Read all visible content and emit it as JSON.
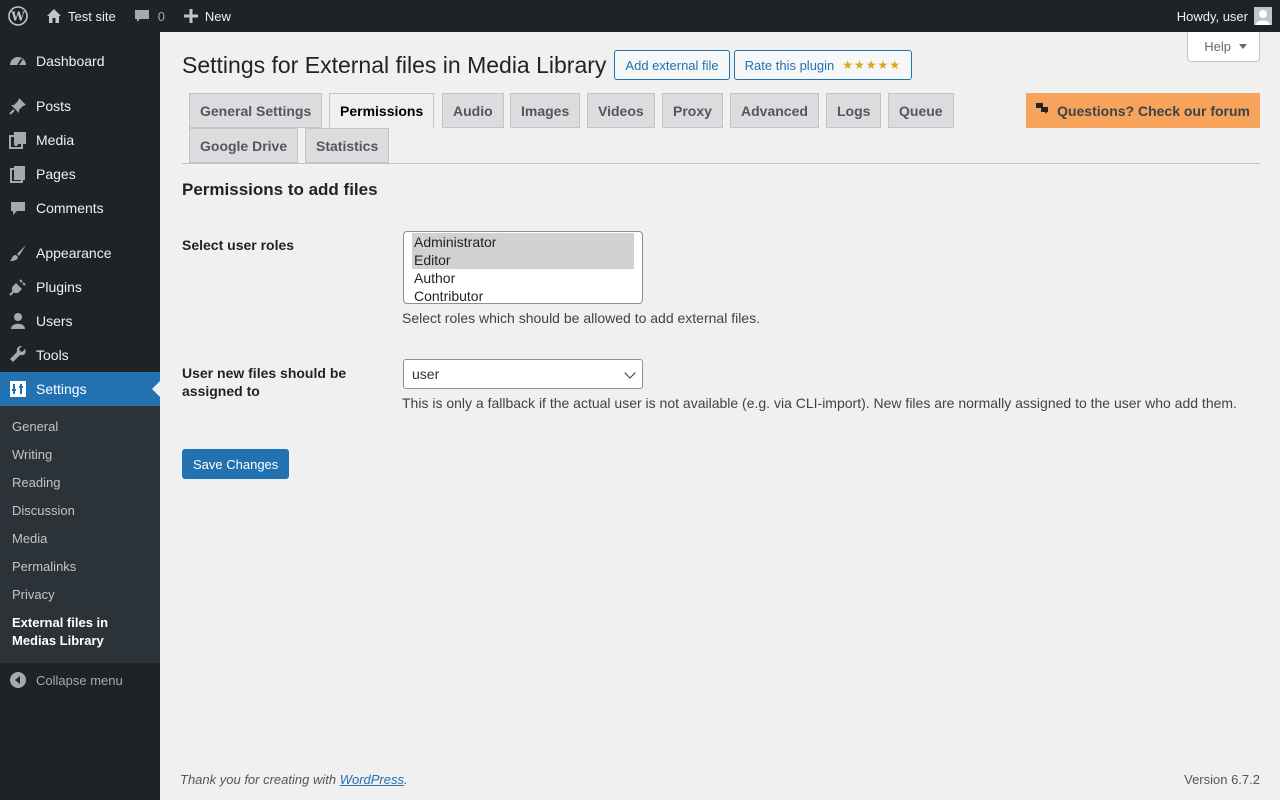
{
  "adminbar": {
    "site_name": "Test site",
    "comments_count": "0",
    "new_label": "New",
    "howdy": "Howdy, user"
  },
  "sidebar": {
    "items": [
      {
        "label": "Dashboard",
        "icon": "dashboard-icon"
      },
      {
        "label": "Posts",
        "icon": "pin-icon"
      },
      {
        "label": "Media",
        "icon": "media-icon"
      },
      {
        "label": "Pages",
        "icon": "pages-icon"
      },
      {
        "label": "Comments",
        "icon": "comment-icon"
      },
      {
        "label": "Appearance",
        "icon": "brush-icon"
      },
      {
        "label": "Plugins",
        "icon": "plug-icon"
      },
      {
        "label": "Users",
        "icon": "user-icon"
      },
      {
        "label": "Tools",
        "icon": "wrench-icon"
      },
      {
        "label": "Settings",
        "icon": "settings-icon"
      }
    ],
    "submenu": [
      "General",
      "Writing",
      "Reading",
      "Discussion",
      "Media",
      "Permalinks",
      "Privacy",
      "External files in Medias Library"
    ],
    "collapse_label": "Collapse menu"
  },
  "header": {
    "help_label": "Help",
    "title": "Settings for External files in Media Library",
    "add_button": "Add external file",
    "rate_button": "Rate this plugin",
    "stars": "★★★★★"
  },
  "tabs": [
    "General Settings",
    "Permissions",
    "Audio",
    "Images",
    "Videos",
    "Proxy",
    "Advanced",
    "Logs",
    "Queue",
    "Google Drive",
    "Statistics"
  ],
  "forum_button": "Questions? Check our forum",
  "section": {
    "title": "Permissions to add files",
    "roles_label": "Select user roles",
    "roles": [
      {
        "label": "Administrator",
        "selected": true
      },
      {
        "label": "Editor",
        "selected": true
      },
      {
        "label": "Author",
        "selected": false
      },
      {
        "label": "Contributor",
        "selected": false
      }
    ],
    "roles_desc": "Select roles which should be allowed to add external files.",
    "assign_label": "User new files should be assigned to",
    "assign_value": "user",
    "assign_desc": "This is only a fallback if the actual user is not available (e.g. via CLI-import). New files are normally assigned to the user who add them.",
    "save_label": "Save Changes"
  },
  "footer": {
    "thanks_prefix": "Thank you for creating with ",
    "thanks_link": "WordPress",
    "thanks_suffix": ".",
    "version": "Version 6.7.2"
  },
  "colors": {
    "accent": "#2271b1",
    "forum": "#f7a35c",
    "sidebar_bg": "#1d2327"
  }
}
